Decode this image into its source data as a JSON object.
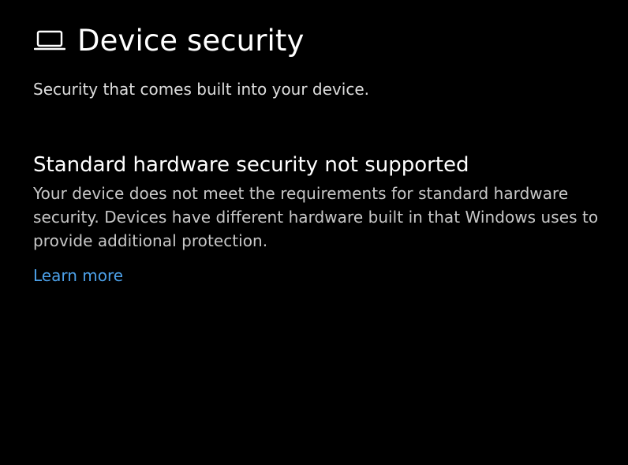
{
  "header": {
    "icon": "laptop-icon",
    "title": "Device security"
  },
  "subtitle": "Security that comes built into your device.",
  "section": {
    "heading": "Standard hardware security not supported",
    "body": "Your device does not meet the requirements for standard hardware security. Devices have different hardware built in that Windows uses to provide additional protection.",
    "link_label": "Learn more"
  },
  "colors": {
    "background": "#000000",
    "heading_text": "#ffffff",
    "body_text": "#c8c8c8",
    "link": "#4ca0e8"
  }
}
